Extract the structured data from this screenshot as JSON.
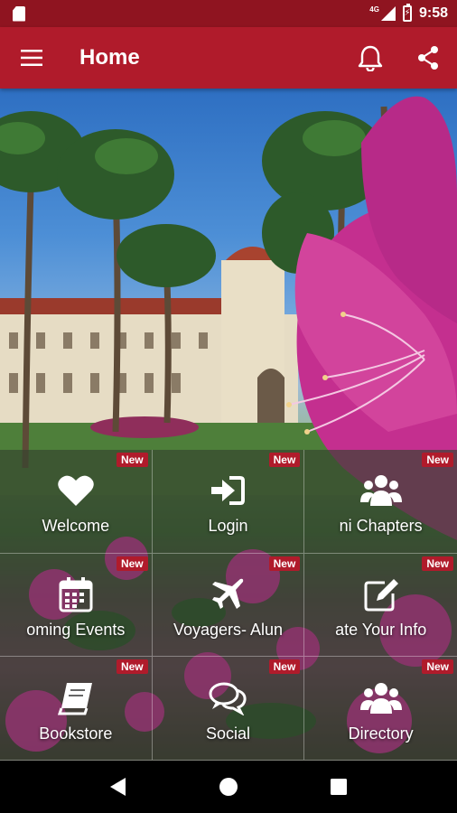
{
  "status_bar": {
    "time": "9:58",
    "network_type": "4G",
    "battery_glyph": "⚡"
  },
  "app_bar": {
    "title": "Home",
    "menu_icon": "hamburger-menu-icon",
    "notifications_icon": "bell-icon",
    "share_icon": "share-icon",
    "color": "#b01b2b"
  },
  "tiles": [
    {
      "label": "Welcome",
      "icon": "heart-icon",
      "badge": "New"
    },
    {
      "label": "Login",
      "icon": "sign-in-icon",
      "badge": "New"
    },
    {
      "label": "ni Chapters",
      "icon": "users-icon",
      "badge": "New"
    },
    {
      "label": "oming Events",
      "icon": "calendar-icon",
      "badge": "New"
    },
    {
      "label": "Voyagers- Alun",
      "icon": "airplane-icon",
      "badge": "New"
    },
    {
      "label": "ate Your Info",
      "icon": "edit-icon",
      "badge": "New"
    },
    {
      "label": "Bookstore",
      "icon": "book-icon",
      "badge": "New"
    },
    {
      "label": "Social",
      "icon": "chat-bubbles-icon",
      "badge": "New"
    },
    {
      "label": "Directory",
      "icon": "users-icon",
      "badge": "New"
    }
  ],
  "nav_bar": {
    "back_icon": "back-triangle-icon",
    "home_icon": "home-circle-icon",
    "recents_icon": "recents-square-icon"
  }
}
